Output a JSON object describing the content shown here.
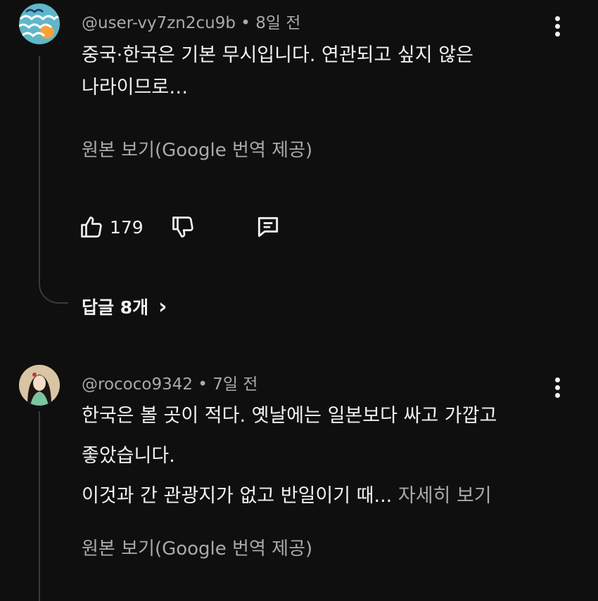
{
  "comment1": {
    "handle": "@user-vy7zn2cu9b",
    "time": "8일 전",
    "lines": [
      "중국·한국은 기본 무시입니다. 연관되고 싶지 않은",
      "나라이므로…"
    ],
    "translate_link": "원본 보기(Google 번역 제공)",
    "like_count": "179",
    "replies_label": "답글 8개",
    "replies_chevron": "›"
  },
  "comment2": {
    "handle": "@rococo9342",
    "time": "7일 전",
    "lines": [
      "한국은 볼 곳이 적다. 옛날에는 일본보다 싸고 가깝고",
      "좋았습니다.",
      "이것과 간 관광지가 없고 반일이기 때..."
    ],
    "read_more": "자세히 보기",
    "translate_link": "원본 보기(Google 번역 제공)"
  },
  "separator": "•",
  "colors": {
    "background": "#0f0f0f",
    "text": "#f1f1f1",
    "secondary": "#aaaaaa",
    "thread": "#3a3a3a"
  }
}
